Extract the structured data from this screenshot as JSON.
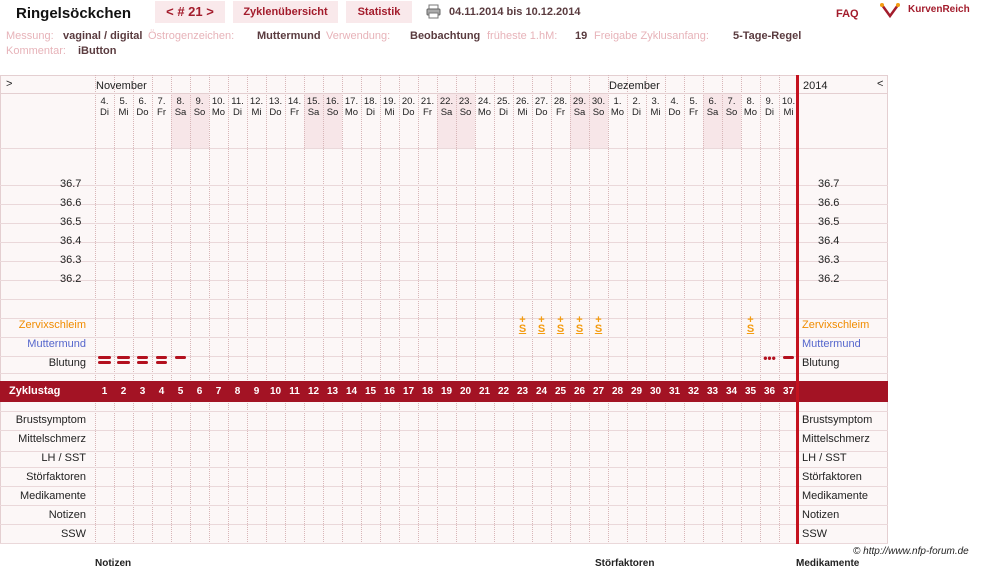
{
  "header": {
    "title": "Ringelsöckchen",
    "cycle_nav": "< # 21 >",
    "tab_overview": "Zyklenübersicht",
    "tab_stats": "Statistik",
    "date_range": "04.11.2014 bis 10.12.2014",
    "faq": "FAQ",
    "brand": "KurvenReich"
  },
  "meta": {
    "messung_label": "Messung:",
    "messung": "vaginal / digital",
    "oestrogen_label": "Östrogenzeichen:",
    "oestrogen": "Muttermund",
    "verwendung_label": "Verwendung:",
    "verwendung": "Beobachtung",
    "hm_label": "früheste 1.hM:",
    "hm": "19",
    "freigabe_label": "Freigabe Zyklusanfang:",
    "freigabe": "5-Tage-Regel",
    "kommentar_label": "Kommentar:",
    "kommentar": "iButton"
  },
  "nav": {
    "left": ">",
    "right": "<",
    "year": "2014"
  },
  "months": [
    {
      "name": "November"
    },
    {
      "name": "Dezember"
    }
  ],
  "days": [
    {
      "d": "4.",
      "w": "Di"
    },
    {
      "d": "5.",
      "w": "Mi"
    },
    {
      "d": "6.",
      "w": "Do"
    },
    {
      "d": "7.",
      "w": "Fr"
    },
    {
      "d": "8.",
      "w": "Sa"
    },
    {
      "d": "9.",
      "w": "So"
    },
    {
      "d": "10.",
      "w": "Mo"
    },
    {
      "d": "11.",
      "w": "Di"
    },
    {
      "d": "12.",
      "w": "Mi"
    },
    {
      "d": "13.",
      "w": "Do"
    },
    {
      "d": "14.",
      "w": "Fr"
    },
    {
      "d": "15.",
      "w": "Sa"
    },
    {
      "d": "16.",
      "w": "So"
    },
    {
      "d": "17.",
      "w": "Mo"
    },
    {
      "d": "18.",
      "w": "Di"
    },
    {
      "d": "19.",
      "w": "Mi"
    },
    {
      "d": "20.",
      "w": "Do"
    },
    {
      "d": "21.",
      "w": "Fr"
    },
    {
      "d": "22.",
      "w": "Sa"
    },
    {
      "d": "23.",
      "w": "So"
    },
    {
      "d": "24.",
      "w": "Mo"
    },
    {
      "d": "25.",
      "w": "Di"
    },
    {
      "d": "26.",
      "w": "Mi"
    },
    {
      "d": "27.",
      "w": "Do"
    },
    {
      "d": "28.",
      "w": "Fr"
    },
    {
      "d": "29.",
      "w": "Sa"
    },
    {
      "d": "30.",
      "w": "So"
    },
    {
      "d": "1.",
      "w": "Mo"
    },
    {
      "d": "2.",
      "w": "Di"
    },
    {
      "d": "3.",
      "w": "Mi"
    },
    {
      "d": "4.",
      "w": "Do"
    },
    {
      "d": "5.",
      "w": "Fr"
    },
    {
      "d": "6.",
      "w": "Sa"
    },
    {
      "d": "7.",
      "w": "So"
    },
    {
      "d": "8.",
      "w": "Mo"
    },
    {
      "d": "9.",
      "w": "Di"
    },
    {
      "d": "10.",
      "w": "Mi"
    }
  ],
  "temps": [
    "36.7",
    "36.6",
    "36.5",
    "36.4",
    "36.3",
    "36.2"
  ],
  "rows": {
    "zervix": "Zervixschleim",
    "muttermund": "Muttermund",
    "blutung": "Blutung",
    "zyklustag": "Zyklustag",
    "brust": "Brustsymptom",
    "mittel": "Mittelschmerz",
    "lh": "LH / SST",
    "stoer": "Störfaktoren",
    "medi": "Medikamente",
    "notizen": "Notizen",
    "ssw": "SSW"
  },
  "zervix_symbol": "S",
  "zervix_days": [
    23,
    24,
    25,
    26,
    27,
    35
  ],
  "bleeding": {
    "heavy": [
      1,
      2
    ],
    "medium": [
      3,
      4
    ],
    "light": [
      5
    ],
    "spotting": [
      36
    ],
    "light_end": [
      37
    ]
  },
  "cycle_days": [
    "1",
    "2",
    "3",
    "4",
    "5",
    "6",
    "7",
    "8",
    "9",
    "10",
    "11",
    "12",
    "13",
    "14",
    "15",
    "16",
    "17",
    "18",
    "19",
    "20",
    "21",
    "22",
    "23",
    "24",
    "25",
    "26",
    "27",
    "28",
    "29",
    "30",
    "31",
    "32",
    "33",
    "34",
    "35",
    "36",
    "37"
  ],
  "footer": {
    "copyright": "© http://www.nfp-forum.de",
    "notizen": "Notizen",
    "stoerfaktoren": "Störfaktoren",
    "medikamente": "Medikamente"
  },
  "colors": {
    "accent": "#a31c2c",
    "zervix": "#f39c12",
    "muttermund": "#5566cc",
    "weekend": "#f7e6e8"
  }
}
